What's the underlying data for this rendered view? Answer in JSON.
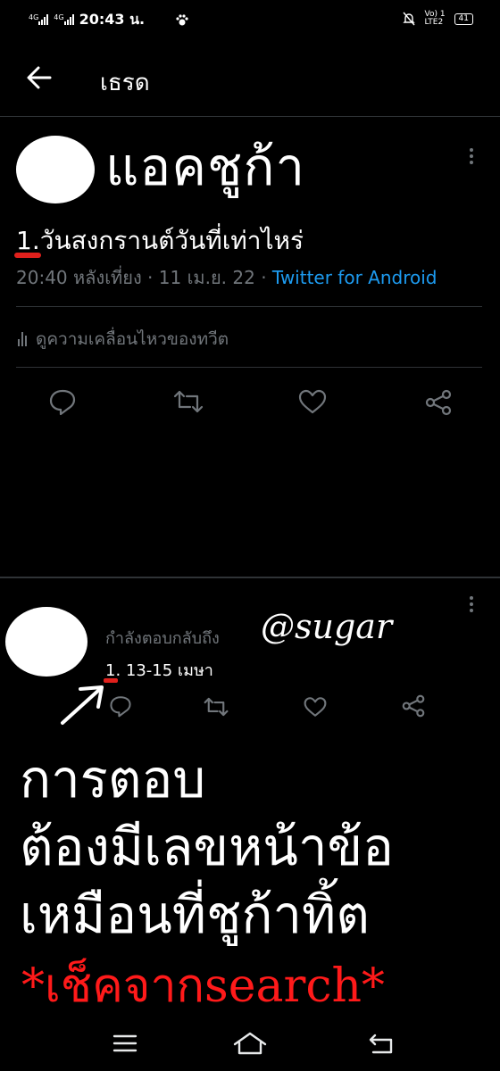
{
  "status_bar": {
    "net1": "4G",
    "net2": "4G",
    "time": "20:43 น.",
    "volte": "Vo) 1",
    "lte": "LTE2",
    "battery": "41"
  },
  "header": {
    "title": "เธรด"
  },
  "tweet": {
    "handwritten_name": "แอคชูก้า",
    "text": "1.วันสงกรานต์วันที่เท่าไหร่",
    "time": "20:40 หลังเที่ยง · 11 เม.ย. 22 · ",
    "source": "Twitter for Android",
    "activity": "ดูความเคลื่อนไหวของทวีต"
  },
  "reply": {
    "replying_to": "กำลังตอบกลับถึง",
    "handwritten_user": "@sugar",
    "text": "1. 13-15 เมษา"
  },
  "annotation": {
    "line1": "การตอบ",
    "line2": "ต้องมีเลขหน้าข้อ",
    "line3": "เหมือนที่ชูก้าทิ้ต",
    "line4": "*เช็คจากsearch*"
  },
  "colors": {
    "background": "#000000",
    "muted": "#71767b",
    "link": "#1d9bf0",
    "annotation_red": "#ff1a1a"
  }
}
